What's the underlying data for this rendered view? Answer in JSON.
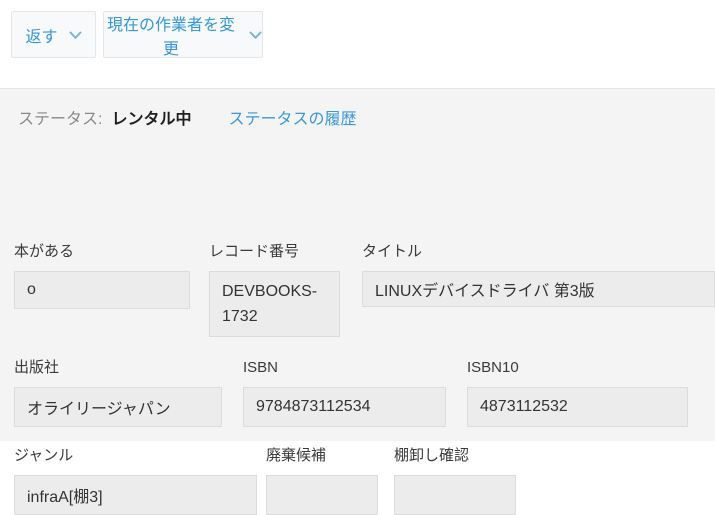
{
  "toolbar": {
    "buttons": [
      {
        "label": "返す",
        "icon": "chevron-down-icon"
      },
      {
        "label": "現在の作業者を変更",
        "icon": "chevron-down-icon"
      }
    ]
  },
  "status": {
    "label": "ステータス:",
    "value": "レンタル中",
    "history_link": "ステータスの履歴"
  },
  "fields": [
    {
      "label": "本がある",
      "value": "o"
    },
    {
      "label": "レコード番号",
      "value": "DEVBOOKS-1732"
    },
    {
      "label": "タイトル",
      "value": "LINUXデバイスドライバ 第3版"
    },
    {
      "label": "出版社",
      "value": "オライリージャパン"
    },
    {
      "label": "ISBN",
      "value": "9784873112534"
    },
    {
      "label": "ISBN10",
      "value": "4873112532"
    },
    {
      "label": "ジャンル",
      "value": "infraA[棚3]"
    },
    {
      "label": "廃棄候補",
      "value": ""
    },
    {
      "label": "棚卸し確認",
      "value": ""
    }
  ],
  "colors": {
    "accent_blue": "#3498db",
    "chevron_blue": "#74b4e4",
    "button_bg": "#f7f9fa",
    "button_border": "#e3e7e8",
    "section_bg": "#f4f4f4",
    "field_bg": "#ececec",
    "field_border": "#dcdcdc",
    "status_label_gray": "#898989"
  }
}
